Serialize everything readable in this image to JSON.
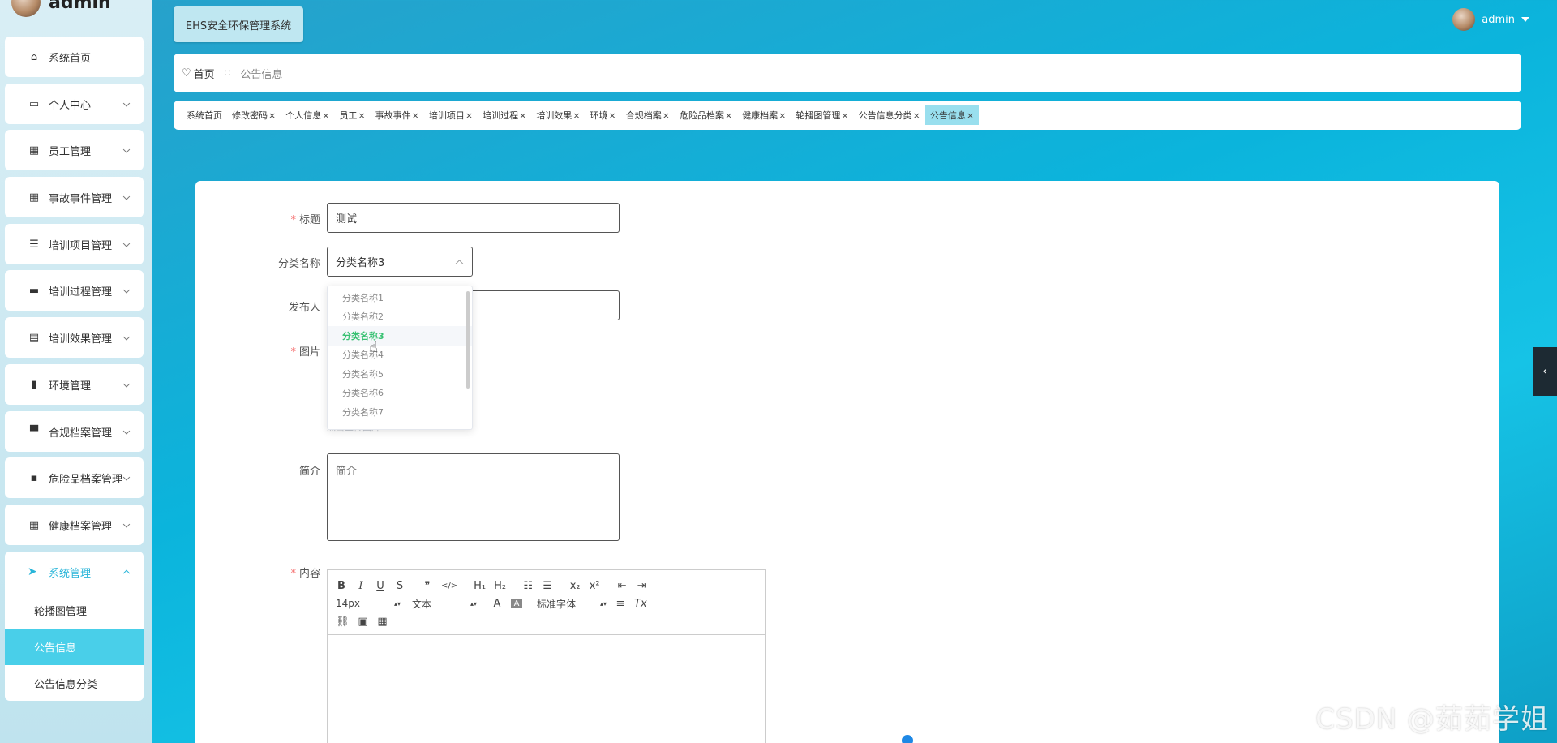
{
  "app": {
    "title": "EHS安全环保管理系统",
    "user": "admin"
  },
  "sidebar": {
    "user_name": "admin",
    "items": [
      {
        "label": "系统首页",
        "icon": "home-icon"
      },
      {
        "label": "个人中心",
        "icon": "id-card-icon"
      },
      {
        "label": "员工管理",
        "icon": "grid-icon"
      },
      {
        "label": "事故事件管理",
        "icon": "grid-icon"
      },
      {
        "label": "培训项目管理",
        "icon": "list-icon"
      },
      {
        "label": "培训过程管理",
        "icon": "briefcase-icon"
      },
      {
        "label": "培训效果管理",
        "icon": "clipboard-icon"
      },
      {
        "label": "环境管理",
        "icon": "bar-chart-icon"
      },
      {
        "label": "合规档案管理",
        "icon": "monitor-icon"
      },
      {
        "label": "危险品档案管理",
        "icon": "chat-icon"
      },
      {
        "label": "健康档案管理",
        "icon": "grid-icon"
      }
    ],
    "group": {
      "label": "系统管理",
      "icon": "send-icon",
      "children": [
        "轮播图管理",
        "公告信息",
        "公告信息分类"
      ],
      "active_child": "公告信息"
    }
  },
  "breadcrumb": {
    "home": "首页",
    "separator": "∷",
    "current": "公告信息"
  },
  "tags": [
    {
      "label": "系统首页",
      "closable": false
    },
    {
      "label": "修改密码",
      "closable": true
    },
    {
      "label": "个人信息",
      "closable": true
    },
    {
      "label": "员工",
      "closable": true
    },
    {
      "label": "事故事件",
      "closable": true
    },
    {
      "label": "培训项目",
      "closable": true
    },
    {
      "label": "培训过程",
      "closable": true
    },
    {
      "label": "培训效果",
      "closable": true
    },
    {
      "label": "环境",
      "closable": true
    },
    {
      "label": "合规档案",
      "closable": true
    },
    {
      "label": "危险品档案",
      "closable": true
    },
    {
      "label": "健康档案",
      "closable": true
    },
    {
      "label": "轮播图管理",
      "closable": true
    },
    {
      "label": "公告信息分类",
      "closable": true
    },
    {
      "label": "公告信息",
      "closable": true,
      "active": true
    }
  ],
  "form": {
    "title_label": "标题",
    "title_value": "测试",
    "category_label": "分类名称",
    "category_value": "分类名称3",
    "category_options": [
      "分类名称1",
      "分类名称2",
      "分类名称3",
      "分类名称4",
      "分类名称5",
      "分类名称6",
      "分类名称7"
    ],
    "publisher_label": "发布人",
    "image_label": "图片",
    "upload_hint": "点击上传图片",
    "intro_label": "简介",
    "intro_placeholder": "简介",
    "content_label": "内容"
  },
  "editor": {
    "font_size": "14px",
    "header": "文本",
    "font_family": "标准字体",
    "buttons": [
      "B",
      "I",
      "U",
      "S",
      "❞",
      "</>",
      "H1",
      "H2",
      "ol",
      "ul",
      "x₂",
      "x²",
      "outdent",
      "indent",
      "A",
      "A-bg",
      "align",
      "Tx",
      "link",
      "image",
      "video"
    ]
  },
  "watermark": "CSDN @茹茹学姐",
  "colors": {
    "accent": "#29b5d9",
    "active_bg": "#49cfe9",
    "selected_option": "#38c172",
    "required": "#f56c6c"
  }
}
